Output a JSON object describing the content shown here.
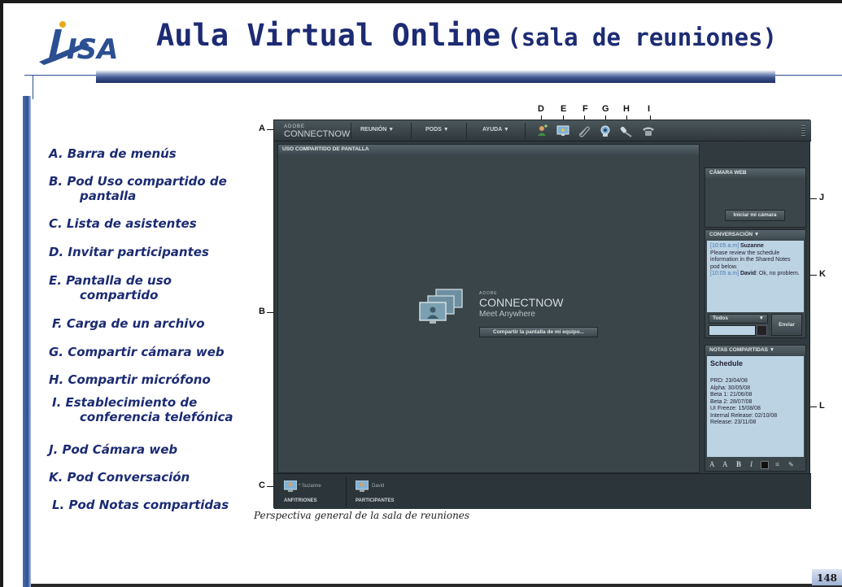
{
  "slide": {
    "title_main": "Aula Virtual Online",
    "title_sub": "(sala de reuniones)",
    "logo_text": "ISA",
    "page_number": "148",
    "caption": "Perspectiva general de la sala de reuniones"
  },
  "legend": [
    "A. Barra de menús",
    "B. Pod Uso compartido de",
    "pantalla",
    "C. Lista de asistentes",
    "D. Invitar participantes",
    "E. Pantalla de uso",
    "compartido",
    "F. Carga de un archivo",
    "G. Compartir cámara web",
    "H. Compartir micrófono",
    "I. Establecimiento de",
    "conferencia telefónica",
    "J. Pod Cámara web",
    "K. Pod Conversación",
    "L. Pod Notas compartidas"
  ],
  "callouts": {
    "A": "A",
    "B": "B",
    "C": "C",
    "D": "D",
    "E": "E",
    "F": "F",
    "G": "G",
    "H": "H",
    "I": "I",
    "J": "J",
    "K": "K",
    "L": "L"
  },
  "app": {
    "logo_small": "ADOBE",
    "logo": "CONNECTNOW",
    "menu": [
      "REUNIÓN ▼",
      "PODS ▼",
      "AYUDA ▼"
    ],
    "toolbar_icons": [
      "invite-icon",
      "share-screen-icon",
      "upload-file-icon",
      "webcam-icon",
      "microphone-icon",
      "phone-icon"
    ],
    "screen_share": {
      "header": "USO COMPARTIDO DE PANTALLA",
      "brand_small": "ADOBE",
      "brand": "CONNECTNOW",
      "tagline": "Meet Anywhere",
      "share_button": "Compartir la pantalla de mi equipo..."
    },
    "webcam": {
      "header": "CÁMARA WEB",
      "start_button": "Iniciar mi cámara"
    },
    "chat": {
      "header": "CONVERSACIÓN ▼",
      "msg1_time": "[10:05 a.m]",
      "msg1_user": "Suzanne",
      "msg1_text": "Please review the schedule information in the Shared Notes pod below.",
      "msg2_time": "[10:05 a.m]",
      "msg2_user": "David",
      "msg2_text": ": Ok, no problem.",
      "recipient": "Todos",
      "send_button": "Enviar"
    },
    "notes": {
      "header": "NOTAS COMPARTIDAS ▼",
      "title": "Schedule",
      "lines": [
        "PRD: 23/04/08",
        "Alpha: 30/05/08",
        "Beta 1: 21/06/08",
        "Beta 2: 28/07/08",
        "UI Freeze: 15/08/08",
        "Internal Release: 02/10/08",
        "Release: 23/11/08"
      ],
      "format_buttons": [
        "A",
        "A",
        "B",
        "I",
        "≡"
      ]
    },
    "attendees": {
      "hosts_label": "ANFITRIONES",
      "host_name": "* Suzanne",
      "participants_label": "PARTICIPANTES",
      "participant_name": "David"
    }
  },
  "colors": {
    "title": "#1c2b73",
    "accent_bar": "#2b4f92",
    "app_bg": "#303a3f",
    "pane_light": "#bcd3e4",
    "chat_time": "#4a78b0"
  }
}
